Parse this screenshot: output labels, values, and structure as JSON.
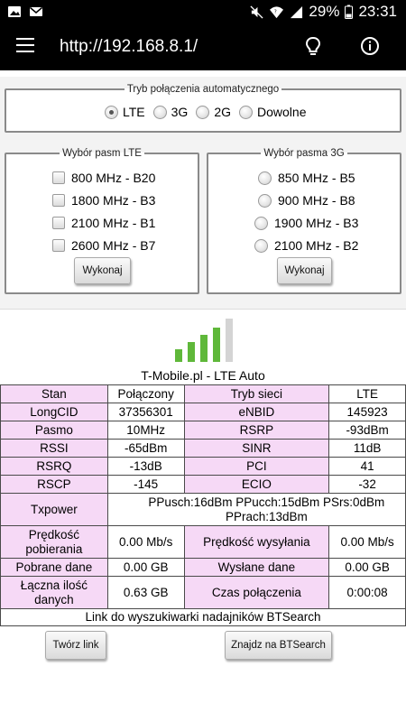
{
  "statusbar": {
    "battery": "29%",
    "time": "23:31"
  },
  "appbar": {
    "url": "http://192.168.8.1/"
  },
  "mode": {
    "legend": "Tryb połączenia automatycznego",
    "options": [
      "LTE",
      "3G",
      "2G",
      "Dowolne"
    ],
    "selected": "LTE"
  },
  "lte": {
    "legend": "Wybór pasm LTE",
    "bands": [
      "800 MHz - B20",
      "1800 MHz - B3",
      "2100 MHz - B1",
      "2600 MHz - B7"
    ],
    "button": "Wykonaj"
  },
  "umts": {
    "legend": "Wybór pasma 3G",
    "bands": [
      "850 MHz - B5",
      "900 MHz - B8",
      "1900 MHz - B3",
      "2100 MHz - B2"
    ],
    "button": "Wykonaj"
  },
  "signal": {
    "level": 4,
    "max": 5,
    "active_color": "#5fb83a",
    "inactive_color": "#d4d4d4"
  },
  "operator": "T-Mobile.pl - LTE Auto",
  "table": {
    "rows": [
      [
        "Stan",
        "Połączony",
        "Tryb sieci",
        "LTE"
      ],
      [
        "LongCID",
        "37356301",
        "eNBID",
        "145923"
      ],
      [
        "Pasmo",
        "10MHz",
        "RSRP",
        "-93dBm"
      ],
      [
        "RSSI",
        "-65dBm",
        "SINR",
        "11dB"
      ],
      [
        "RSRQ",
        "-13dB",
        "PCI",
        "41"
      ],
      [
        "RSCP",
        "-145",
        "ECIO",
        "-32"
      ]
    ],
    "txpower_label": "Txpower",
    "txpower_value": "PPusch:16dBm PPucch:15dBm PSrs:0dBm PPrach:13dBm",
    "speed_down_label": "Prędkość pobierania",
    "speed_down": "0.00 Mb/s",
    "speed_up_label": "Prędkość wysyłania",
    "speed_up": "0.00 Mb/s",
    "downloaded_label": "Pobrane dane",
    "downloaded": "0.00 GB",
    "uploaded_label": "Wysłane dane",
    "uploaded": "0.00 GB",
    "total_label": "Łączna ilość danych",
    "total": "0.63 GB",
    "time_label": "Czas połączenia",
    "time": "0:00:08"
  },
  "btsearch": {
    "text": "Link do wyszukiwarki nadajników BTSearch",
    "create_link": "Twórz link",
    "find": "Znajdz na BTSearch"
  }
}
